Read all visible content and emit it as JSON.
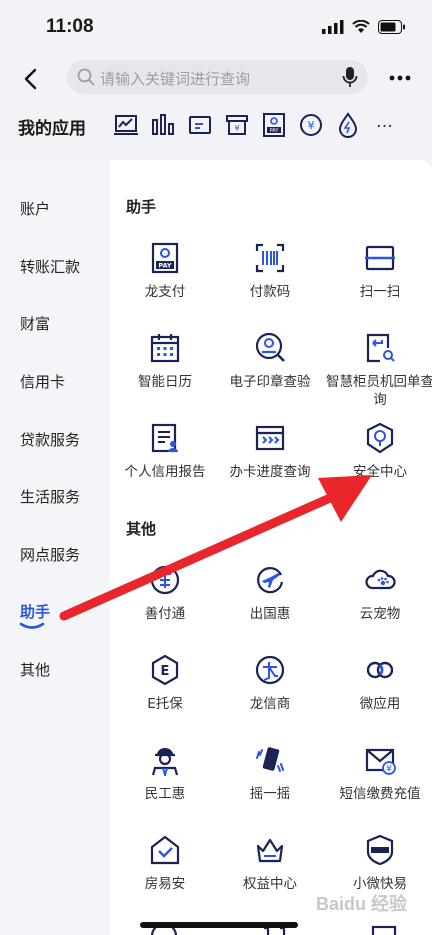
{
  "status": {
    "time": "11:08"
  },
  "search": {
    "placeholder": "请输入关键词进行查询"
  },
  "my_apps": {
    "title": "我的应用",
    "more": "…"
  },
  "sidebar": {
    "items": [
      {
        "label": "账户"
      },
      {
        "label": "转账汇款"
      },
      {
        "label": "财富"
      },
      {
        "label": "信用卡"
      },
      {
        "label": "贷款服务"
      },
      {
        "label": "生活服务"
      },
      {
        "label": "网点服务"
      },
      {
        "label": "助手",
        "active": true
      },
      {
        "label": "其他"
      }
    ]
  },
  "sections": [
    {
      "title": "助手",
      "items": [
        {
          "label": "龙支付",
          "icon": "long-pay-icon"
        },
        {
          "label": "付款码",
          "icon": "payment-code-icon"
        },
        {
          "label": "扫一扫",
          "icon": "scan-icon"
        },
        {
          "label": "智能日历",
          "icon": "calendar-icon"
        },
        {
          "label": "电子印章查验",
          "icon": "seal-verify-icon"
        },
        {
          "label": "智慧柜员机回单查询",
          "icon": "receipt-query-icon"
        },
        {
          "label": "个人信用报告",
          "icon": "credit-report-icon"
        },
        {
          "label": "办卡进度查询",
          "icon": "card-progress-icon"
        },
        {
          "label": "安全中心",
          "icon": "security-center-icon"
        }
      ]
    },
    {
      "title": "其他",
      "items": [
        {
          "label": "善付通",
          "icon": "shanfutong-icon"
        },
        {
          "label": "出国惠",
          "icon": "travel-abroad-icon"
        },
        {
          "label": "云宠物",
          "icon": "cloud-pet-icon"
        },
        {
          "label": "E托保",
          "icon": "e-tuobao-icon"
        },
        {
          "label": "龙信商",
          "icon": "long-xinshang-icon"
        },
        {
          "label": "微应用",
          "icon": "micro-app-icon"
        },
        {
          "label": "民工惠",
          "icon": "worker-icon"
        },
        {
          "label": "摇一摇",
          "icon": "shake-icon"
        },
        {
          "label": "短信缴费充值",
          "icon": "sms-payment-icon"
        },
        {
          "label": "房易安",
          "icon": "house-icon"
        },
        {
          "label": "权益中心",
          "icon": "rights-center-icon"
        },
        {
          "label": "小微快易",
          "icon": "small-biz-icon"
        }
      ]
    }
  ],
  "watermark": "Baidu 经验",
  "colors": {
    "accent": "#2a55e5",
    "icon": "#1b2356",
    "arrow": "#e8262c"
  }
}
